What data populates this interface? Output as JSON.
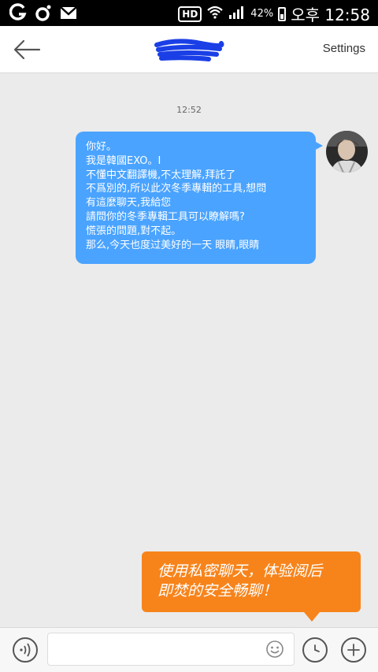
{
  "status_bar": {
    "hd": "HD",
    "battery": "42%",
    "time": "오후 12:58"
  },
  "header": {
    "settings_label": "Settings"
  },
  "chat": {
    "timestamp": "12:52",
    "message_lines": [
      "你好。",
      "我是韓國EXO。I",
      "不懂中文翻譯機,不太理解,拜託了",
      "不爲別的,所以此次冬季專輯的工具,想問",
      "有這麼聊天,我給您",
      "請問你的冬季專輯工具可以瞭解嗎?",
      "慌張的問題,對不起。",
      "那么,今天也度过美好的一天 眼睛,眼睛"
    ]
  },
  "tip": {
    "lines": [
      "使用私密聊天，体验阅后",
      "即焚的安全畅聊！"
    ]
  },
  "input": {
    "value": "",
    "placeholder": ""
  },
  "colors": {
    "bubble": "#4aa3ff",
    "tip": "#f7841b",
    "background": "#ebebeb"
  }
}
